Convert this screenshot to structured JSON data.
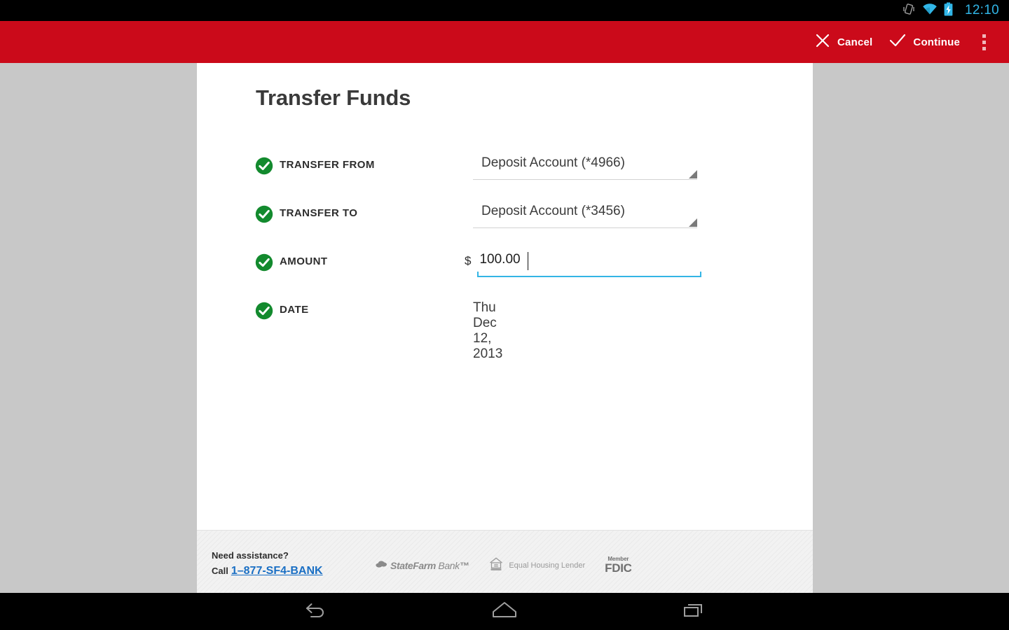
{
  "status_bar": {
    "time": "12:10",
    "icons": [
      "vibrate-icon",
      "wifi-icon",
      "battery-charging-icon"
    ],
    "time_color": "#31b6e7"
  },
  "action_bar": {
    "background_color": "#cb0a1a",
    "cancel_label": "Cancel",
    "continue_label": "Continue",
    "overflow_name": "More options"
  },
  "page": {
    "title": "Transfer Funds"
  },
  "form": {
    "rows": [
      {
        "label": "TRANSFER FROM",
        "type": "spinner",
        "value": "Deposit Account (*4966)",
        "valid": true
      },
      {
        "label": "TRANSFER TO",
        "type": "spinner",
        "value": "Deposit Account (*3456)",
        "valid": true
      },
      {
        "label": "AMOUNT",
        "type": "currency-input",
        "prefix": "$",
        "value": "100.00",
        "valid": true,
        "focused": true
      },
      {
        "label": "DATE",
        "type": "text",
        "value": "Thu Dec 12, 2013",
        "valid": true
      }
    ]
  },
  "footer": {
    "need_assistance": "Need assistance?",
    "call_prefix": "Call",
    "phone": "1–877-SF4-BANK",
    "brand_state": "State",
    "brand_farm": "Farm",
    "brand_bank": "Bank",
    "brand_tm": "™",
    "equal_housing": "Equal Housing Lender",
    "fdic_member": "Member",
    "fdic_text": "FDIC"
  },
  "nav_bar": {
    "back": "back-icon",
    "home": "home-icon",
    "recents": "recents-icon"
  },
  "colors": {
    "brand_red": "#cb0a1a",
    "check_green": "#138a2e",
    "focus_blue": "#33b5e5",
    "link_blue": "#1a6fc4",
    "page_bg": "#c8c8c8"
  }
}
